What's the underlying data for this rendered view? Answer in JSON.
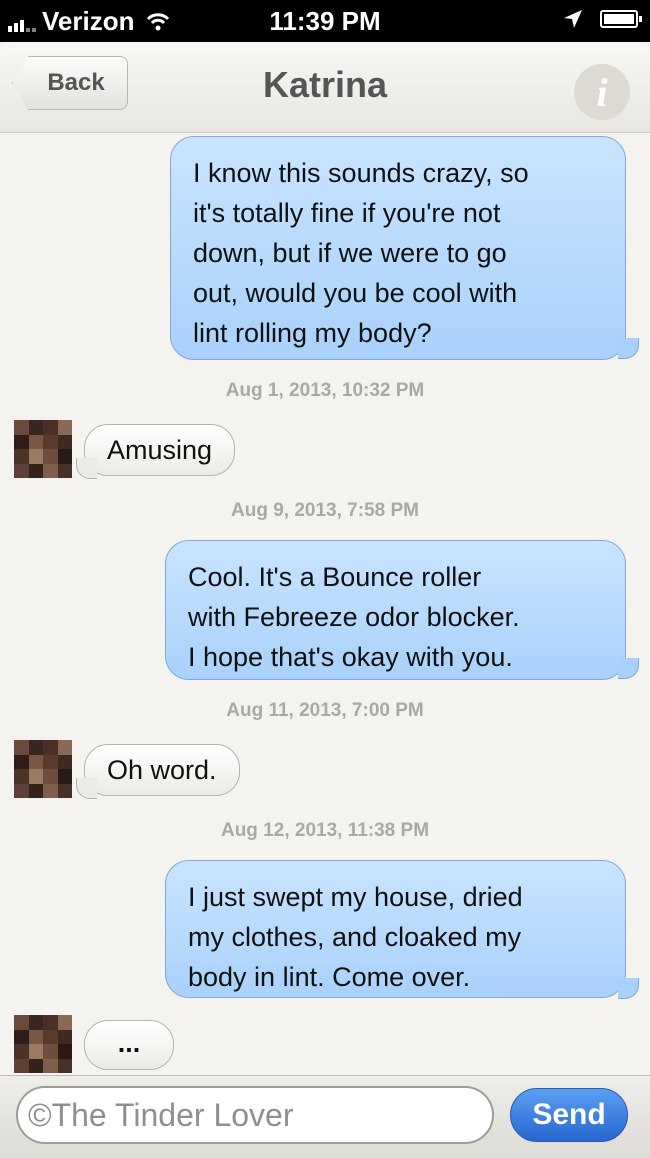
{
  "status_bar": {
    "carrier": "Verizon",
    "time": "11:39 PM"
  },
  "nav": {
    "back_label": "Back",
    "title": "Katrina",
    "info_glyph": "i"
  },
  "messages": [
    {
      "sender": "me",
      "lines": [
        "I know this sounds crazy, so",
        "it's totally fine if you're not",
        "down, but if we were to go",
        "out, would you be cool with",
        "lint rolling my body?"
      ]
    },
    {
      "timestamp": "Aug 1, 2013, 10:32 PM"
    },
    {
      "sender": "Katrina",
      "text": "Amusing"
    },
    {
      "timestamp": "Aug 9, 2013, 7:58 PM"
    },
    {
      "sender": "me",
      "lines": [
        "Cool. It's a Bounce roller",
        "with Febreeze odor blocker.",
        "I hope that's okay with you."
      ]
    },
    {
      "timestamp": "Aug 11, 2013, 7:00 PM"
    },
    {
      "sender": "Katrina",
      "text": "Oh word."
    },
    {
      "timestamp": "Aug 12, 2013, 11:38 PM"
    },
    {
      "sender": "me",
      "lines": [
        "I just swept my house, dried",
        "my clothes, and cloaked my",
        "body in lint. Come over."
      ]
    },
    {
      "sender": "Katrina",
      "text": "..."
    }
  ],
  "input": {
    "field_text": "©The Tinder Lover",
    "send_label": "Send"
  },
  "colors": {
    "outgoing_bubble": "#b4d7fc",
    "incoming_bubble": "#f4f3ef",
    "send_button": "#3b7fe0",
    "background": "#f4f3ef"
  },
  "icons": {
    "info": "info-icon",
    "location": "location-arrow-icon",
    "wifi": "wifi-icon",
    "battery": "battery-icon",
    "signal": "signal-icon"
  }
}
